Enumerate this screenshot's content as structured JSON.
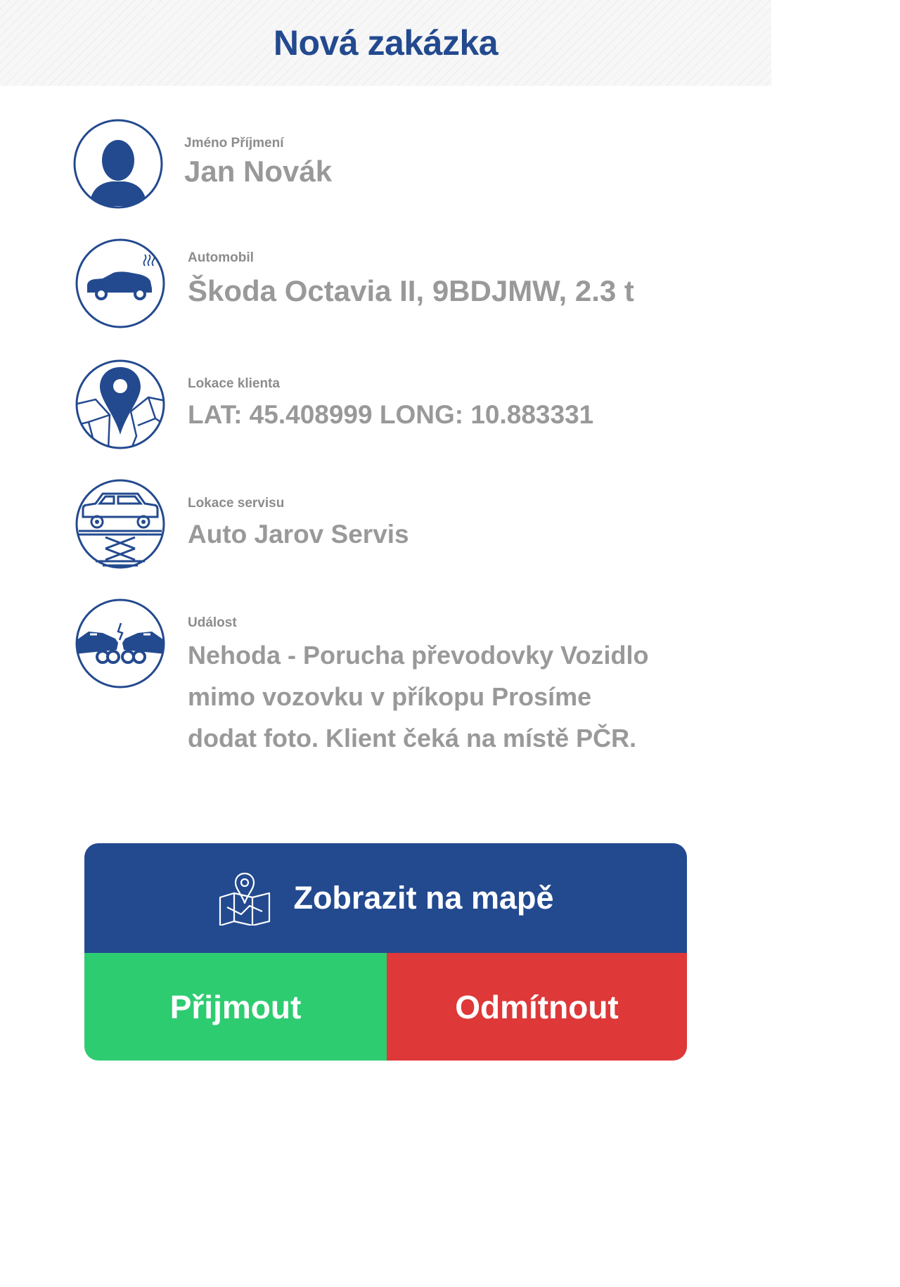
{
  "header": {
    "title": "Nová zakázka"
  },
  "client": {
    "label": "Jméno Příjmení",
    "value": "Jan Novák"
  },
  "vehicle": {
    "label": "Automobil",
    "value": "Škoda Octavia II, 9BDJMW, 2.3 t"
  },
  "client_location": {
    "label": "Lokace klienta",
    "value": "LAT: 45.408999 LONG: 10.883331"
  },
  "service_location": {
    "label": "Lokace servisu",
    "value": "Auto Jarov Servis"
  },
  "event": {
    "label": "Událost",
    "value": "Nehoda - Porucha převodovky Vozidlo mimo vozovku v příkopu Prosíme dodat foto. Klient čeká na místě PČR."
  },
  "actions": {
    "map_label": "Zobrazit na mapě",
    "accept_label": "Přijmout",
    "reject_label": "Odmítnout"
  },
  "icons": {
    "person": "person-icon",
    "car": "smoking-car-icon",
    "location": "map-pin-icon",
    "service": "car-lift-icon",
    "event": "car-crash-icon",
    "map": "folded-map-icon"
  },
  "colors": {
    "brand_blue": "#234a8f",
    "accept_green": "#2ecc71",
    "reject_red": "#de3838",
    "text_gray": "#999999"
  }
}
